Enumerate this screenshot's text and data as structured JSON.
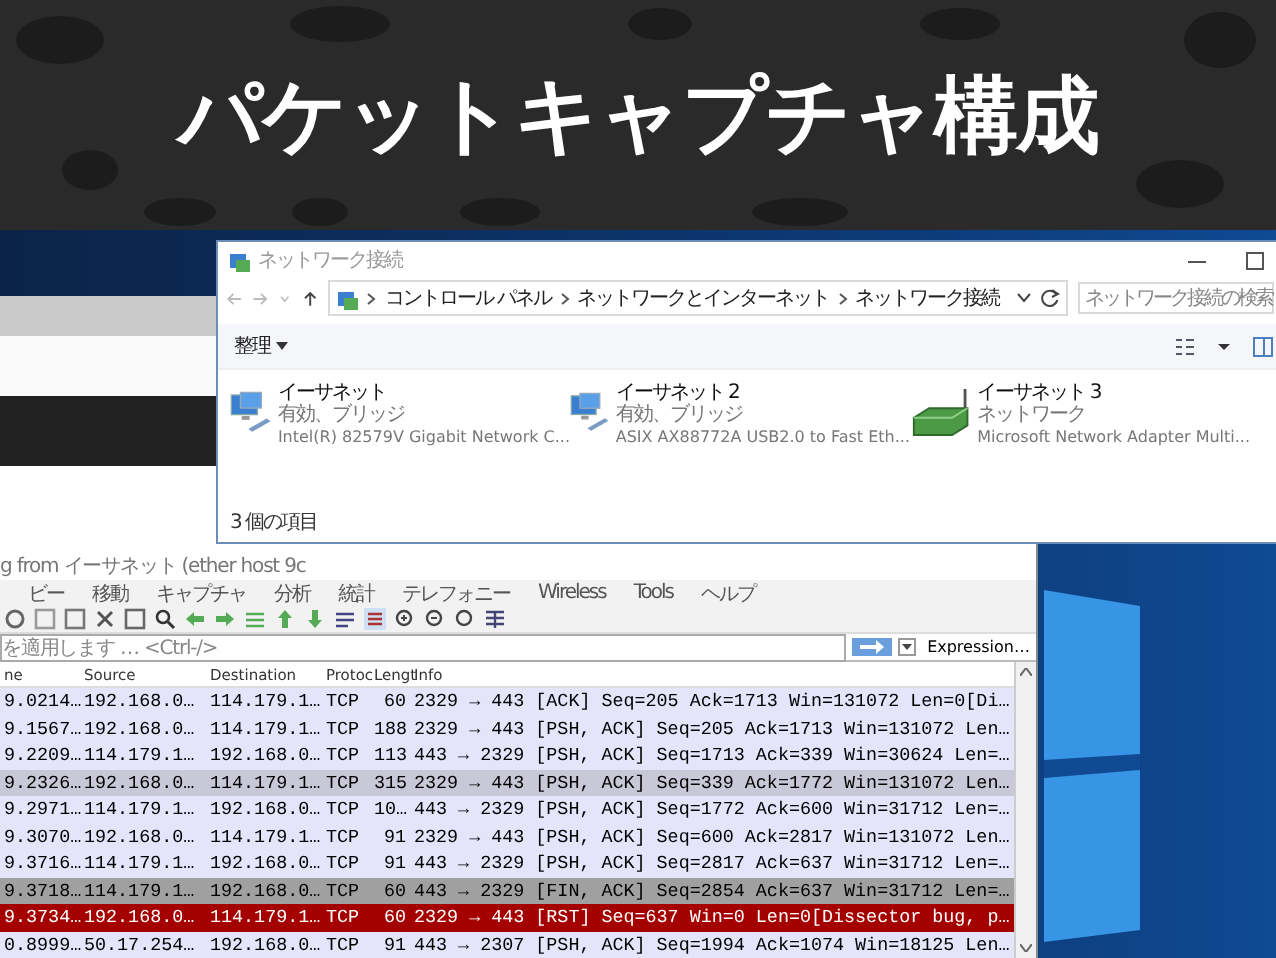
{
  "banner": {
    "title": "パケットキャプチャ構成"
  },
  "explorer": {
    "title": "ネットワーク接続",
    "breadcrumb": [
      "コントロール パネル",
      "ネットワークとインターネット",
      "ネットワーク接続"
    ],
    "search": {
      "placeholder": "ネットワーク接続の検索"
    },
    "organize_button": "整理",
    "items": [
      {
        "kind": "ethernet",
        "name": "イーサネット",
        "status": "有効、ブリッジ",
        "device": "Intel(R) 82579V Gigabit Network C..."
      },
      {
        "kind": "ethernet",
        "name": "イーサネット 2",
        "status": "有効、ブリッジ",
        "device": "ASIX AX88772A USB2.0 to Fast Eth..."
      },
      {
        "kind": "bridge",
        "name": "イーサネット 3",
        "status": "ネットワーク",
        "device": "Microsoft Network Adapter Multi..."
      }
    ],
    "status_bar": "3 個の項目"
  },
  "wireshark": {
    "title": "g from イーサネット (ether host 9c",
    "menu": [
      "ビー",
      "移動",
      "キャプチャ",
      "分析",
      "統計",
      "テレフォニー",
      "Wireless",
      "Tools",
      "ヘルプ"
    ],
    "filter": {
      "placeholder": "を適用します … <Ctrl-/>"
    },
    "expression_button": "Expression…",
    "columns": [
      "ne",
      "Source",
      "Destination",
      "Protoc",
      "Lengt",
      "Info"
    ],
    "rows": [
      {
        "color": "#e4e4fb",
        "cells": [
          "9.0214…",
          "192.168.0…",
          "114.179.1…",
          "TCP",
          "60",
          "2329 → 443 [ACK] Seq=205 Ack=1713 Win=131072 Len=0[Di…"
        ]
      },
      {
        "color": "#e4e4fb",
        "cells": [
          "9.1567…",
          "192.168.0…",
          "114.179.1…",
          "TCP",
          "188",
          "2329 → 443 [PSH, ACK] Seq=205 Ack=1713 Win=131072 Len…"
        ]
      },
      {
        "color": "#e4e4fb",
        "cells": [
          "9.2209…",
          "114.179.1…",
          "192.168.0…",
          "TCP",
          "113",
          "443 → 2329 [PSH, ACK] Seq=1713 Ack=339 Win=30624 Len=…"
        ]
      },
      {
        "color": "#c8c8d8",
        "cells": [
          "9.2326…",
          "192.168.0…",
          "114.179.1…",
          "TCP",
          "315",
          "2329 → 443 [PSH, ACK] Seq=339 Ack=1772 Win=131072 Len…"
        ]
      },
      {
        "color": "#e4e4fb",
        "cells": [
          "9.2971…",
          "114.179.1…",
          "192.168.0…",
          "TCP",
          "10…",
          "443 → 2329 [PSH, ACK] Seq=1772 Ack=600 Win=31712 Len=…"
        ]
      },
      {
        "color": "#e4e4fb",
        "cells": [
          "9.3070…",
          "192.168.0…",
          "114.179.1…",
          "TCP",
          "91",
          "2329 → 443 [PSH, ACK] Seq=600 Ack=2817 Win=131072 Len…"
        ]
      },
      {
        "color": "#e4e4fb",
        "cells": [
          "9.3716…",
          "114.179.1…",
          "192.168.0…",
          "TCP",
          "91",
          "443 → 2329 [PSH, ACK] Seq=2817 Ack=637 Win=31712 Len=…"
        ]
      },
      {
        "color": "#a0a0a0",
        "cells": [
          "9.3718…",
          "114.179.1…",
          "192.168.0…",
          "TCP",
          "60",
          "443 → 2329 [FIN, ACK] Seq=2854 Ack=637 Win=31712 Len=…"
        ]
      },
      {
        "color": "#a40000",
        "cells": [
          "9.3734…",
          "192.168.0…",
          "114.179.1…",
          "TCP",
          "60",
          "2329 → 443 [RST] Seq=637 Win=0 Len=0[Dissector bug, p…"
        ]
      },
      {
        "color": "#e4e4fb",
        "cells": [
          "0.8999…",
          "50.17.254…",
          "192.168.0…",
          "TCP",
          "91",
          "443 → 2307 [PSH, ACK] Seq=1994 Ack=1074 Win=18125 Len…"
        ]
      }
    ]
  }
}
